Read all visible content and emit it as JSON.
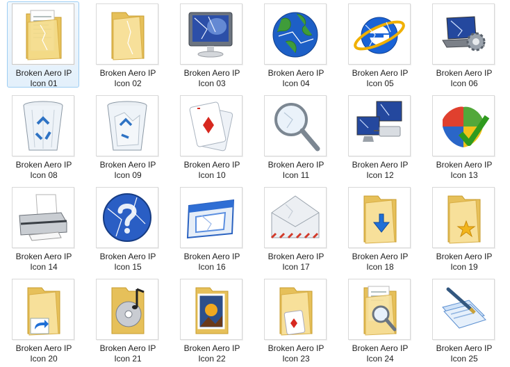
{
  "explorer": {
    "selected_index": 0,
    "items": [
      {
        "line1": "Broken Aero IP",
        "line2": "Icon 01",
        "icon": "document-folder-icon"
      },
      {
        "line1": "Broken Aero IP",
        "line2": "Icon 02",
        "icon": "empty-folder-icon"
      },
      {
        "line1": "Broken Aero IP",
        "line2": "Icon 03",
        "icon": "monitor-icon"
      },
      {
        "line1": "Broken Aero IP",
        "line2": "Icon 04",
        "icon": "globe-icon"
      },
      {
        "line1": "Broken Aero IP",
        "line2": "Icon 05",
        "icon": "internet-explorer-icon"
      },
      {
        "line1": "Broken Aero IP",
        "line2": "Icon 06",
        "icon": "laptop-gear-icon"
      },
      {
        "line1": "Broken Aero IP",
        "line2": "Icon 08",
        "icon": "recycle-bin-empty-icon"
      },
      {
        "line1": "Broken Aero IP",
        "line2": "Icon 09",
        "icon": "recycle-bin-full-icon"
      },
      {
        "line1": "Broken Aero IP",
        "line2": "Icon 10",
        "icon": "playing-cards-icon"
      },
      {
        "line1": "Broken Aero IP",
        "line2": "Icon 11",
        "icon": "magnifier-icon"
      },
      {
        "line1": "Broken Aero IP",
        "line2": "Icon 12",
        "icon": "network-computers-icon"
      },
      {
        "line1": "Broken Aero IP",
        "line2": "Icon 13",
        "icon": "security-shield-icon"
      },
      {
        "line1": "Broken Aero IP",
        "line2": "Icon 14",
        "icon": "printer-icon"
      },
      {
        "line1": "Broken Aero IP",
        "line2": "Icon 15",
        "icon": "help-icon"
      },
      {
        "line1": "Broken Aero IP",
        "line2": "Icon 16",
        "icon": "window-icon"
      },
      {
        "line1": "Broken Aero IP",
        "line2": "Icon 17",
        "icon": "envelope-icon"
      },
      {
        "line1": "Broken Aero IP",
        "line2": "Icon 18",
        "icon": "download-folder-icon"
      },
      {
        "line1": "Broken Aero IP",
        "line2": "Icon 19",
        "icon": "favorites-folder-icon"
      },
      {
        "line1": "Broken Aero IP",
        "line2": "Icon 20",
        "icon": "shortcut-folder-icon"
      },
      {
        "line1": "Broken Aero IP",
        "line2": "Icon 21",
        "icon": "music-folder-icon"
      },
      {
        "line1": "Broken Aero IP",
        "line2": "Icon 22",
        "icon": "pictures-folder-icon"
      },
      {
        "line1": "Broken Aero IP",
        "line2": "Icon 23",
        "icon": "games-folder-icon"
      },
      {
        "line1": "Broken Aero IP",
        "line2": "Icon 24",
        "icon": "search-folder-icon"
      },
      {
        "line1": "Broken Aero IP",
        "line2": "Icon 25",
        "icon": "notepad-icon"
      }
    ]
  }
}
